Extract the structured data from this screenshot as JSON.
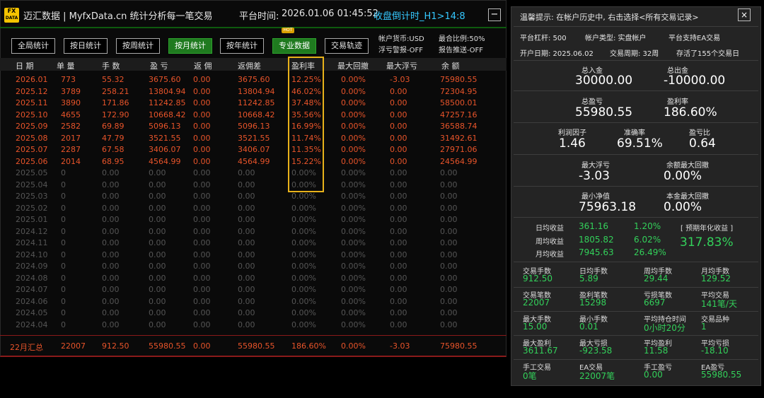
{
  "header": {
    "logo_top": "FX",
    "logo_bottom": "DATA",
    "title": "迈汇数据 | MyfxData.cn  统计分析每一笔交易",
    "platform_time_label": "平台时间:",
    "platform_time": "2026.01.06 01:45:52",
    "countdown": "收盘倒计时_H1>14:8",
    "minimize": "−"
  },
  "tabs": [
    {
      "label": "全局统计"
    },
    {
      "label": "按日统计"
    },
    {
      "label": "按周统计"
    },
    {
      "label": "按月统计"
    },
    {
      "label": "按年统计"
    },
    {
      "label": "专业数据"
    },
    {
      "label": "交易轨迹"
    }
  ],
  "hot_badge": "HOT",
  "info": {
    "currency": "帐户货币:USD",
    "float_alert": "浮亏警报-OFF",
    "max_ratio": "最合比例:50%",
    "report_push": "报告推送-OFF"
  },
  "columns": [
    "日 期",
    "单 量",
    "手 数",
    "盈 亏",
    "返 佣",
    "返佣差",
    "盈利率",
    "最大回撤",
    "最大浮亏",
    "余 额"
  ],
  "rows": [
    {
      "d": "2026.01",
      "n": "773",
      "lots": "55.32",
      "pl": "3675.60",
      "rb": "0.00",
      "rbd": "3675.60",
      "rate": "12.25%",
      "dd": "0.00%",
      "fl": "-3.03",
      "bal": "75980.55",
      "active": true
    },
    {
      "d": "2025.12",
      "n": "3789",
      "lots": "258.21",
      "pl": "13804.94",
      "rb": "0.00",
      "rbd": "13804.94",
      "rate": "46.02%",
      "dd": "0.00%",
      "fl": "0.00",
      "bal": "72304.95",
      "active": true
    },
    {
      "d": "2025.11",
      "n": "3890",
      "lots": "171.86",
      "pl": "11242.85",
      "rb": "0.00",
      "rbd": "11242.85",
      "rate": "37.48%",
      "dd": "0.00%",
      "fl": "0.00",
      "bal": "58500.01",
      "active": true
    },
    {
      "d": "2025.10",
      "n": "4655",
      "lots": "172.90",
      "pl": "10668.42",
      "rb": "0.00",
      "rbd": "10668.42",
      "rate": "35.56%",
      "dd": "0.00%",
      "fl": "0.00",
      "bal": "47257.16",
      "active": true
    },
    {
      "d": "2025.09",
      "n": "2582",
      "lots": "69.89",
      "pl": "5096.13",
      "rb": "0.00",
      "rbd": "5096.13",
      "rate": "16.99%",
      "dd": "0.00%",
      "fl": "0.00",
      "bal": "36588.74",
      "active": true
    },
    {
      "d": "2025.08",
      "n": "2017",
      "lots": "47.79",
      "pl": "3521.55",
      "rb": "0.00",
      "rbd": "3521.55",
      "rate": "11.74%",
      "dd": "0.00%",
      "fl": "0.00",
      "bal": "31492.61",
      "active": true
    },
    {
      "d": "2025.07",
      "n": "2287",
      "lots": "67.58",
      "pl": "3406.07",
      "rb": "0.00",
      "rbd": "3406.07",
      "rate": "11.35%",
      "dd": "0.00%",
      "fl": "0.00",
      "bal": "27971.06",
      "active": true
    },
    {
      "d": "2025.06",
      "n": "2014",
      "lots": "68.95",
      "pl": "4564.99",
      "rb": "0.00",
      "rbd": "4564.99",
      "rate": "15.22%",
      "dd": "0.00%",
      "fl": "0.00",
      "bal": "24564.99",
      "active": true
    },
    {
      "d": "2025.05",
      "n": "0",
      "lots": "0.00",
      "pl": "0.00",
      "rb": "0.00",
      "rbd": "0.00",
      "rate": "0.00%",
      "dd": "0.00%",
      "fl": "0.00",
      "bal": "0.00",
      "active": false
    },
    {
      "d": "2025.04",
      "n": "0",
      "lots": "0.00",
      "pl": "0.00",
      "rb": "0.00",
      "rbd": "0.00",
      "rate": "0.00%",
      "dd": "0.00%",
      "fl": "0.00",
      "bal": "0.00",
      "active": false
    },
    {
      "d": "2025.03",
      "n": "0",
      "lots": "0.00",
      "pl": "0.00",
      "rb": "0.00",
      "rbd": "0.00",
      "rate": "0.00%",
      "dd": "0.00%",
      "fl": "0.00",
      "bal": "0.00",
      "active": false
    },
    {
      "d": "2025.02",
      "n": "0",
      "lots": "0.00",
      "pl": "0.00",
      "rb": "0.00",
      "rbd": "0.00",
      "rate": "0.00%",
      "dd": "0.00%",
      "fl": "0.00",
      "bal": "0.00",
      "active": false
    },
    {
      "d": "2025.01",
      "n": "0",
      "lots": "0.00",
      "pl": "0.00",
      "rb": "0.00",
      "rbd": "0.00",
      "rate": "0.00%",
      "dd": "0.00%",
      "fl": "0.00",
      "bal": "0.00",
      "active": false
    },
    {
      "d": "2024.12",
      "n": "0",
      "lots": "0.00",
      "pl": "0.00",
      "rb": "0.00",
      "rbd": "0.00",
      "rate": "0.00%",
      "dd": "0.00%",
      "fl": "0.00",
      "bal": "0.00",
      "active": false
    },
    {
      "d": "2024.11",
      "n": "0",
      "lots": "0.00",
      "pl": "0.00",
      "rb": "0.00",
      "rbd": "0.00",
      "rate": "0.00%",
      "dd": "0.00%",
      "fl": "0.00",
      "bal": "0.00",
      "active": false
    },
    {
      "d": "2024.10",
      "n": "0",
      "lots": "0.00",
      "pl": "0.00",
      "rb": "0.00",
      "rbd": "0.00",
      "rate": "0.00%",
      "dd": "0.00%",
      "fl": "0.00",
      "bal": "0.00",
      "active": false
    },
    {
      "d": "2024.09",
      "n": "0",
      "lots": "0.00",
      "pl": "0.00",
      "rb": "0.00",
      "rbd": "0.00",
      "rate": "0.00%",
      "dd": "0.00%",
      "fl": "0.00",
      "bal": "0.00",
      "active": false
    },
    {
      "d": "2024.08",
      "n": "0",
      "lots": "0.00",
      "pl": "0.00",
      "rb": "0.00",
      "rbd": "0.00",
      "rate": "0.00%",
      "dd": "0.00%",
      "fl": "0.00",
      "bal": "0.00",
      "active": false
    },
    {
      "d": "2024.07",
      "n": "0",
      "lots": "0.00",
      "pl": "0.00",
      "rb": "0.00",
      "rbd": "0.00",
      "rate": "0.00%",
      "dd": "0.00%",
      "fl": "0.00",
      "bal": "0.00",
      "active": false
    },
    {
      "d": "2024.06",
      "n": "0",
      "lots": "0.00",
      "pl": "0.00",
      "rb": "0.00",
      "rbd": "0.00",
      "rate": "0.00%",
      "dd": "0.00%",
      "fl": "0.00",
      "bal": "0.00",
      "active": false
    },
    {
      "d": "2024.05",
      "n": "0",
      "lots": "0.00",
      "pl": "0.00",
      "rb": "0.00",
      "rbd": "0.00",
      "rate": "0.00%",
      "dd": "0.00%",
      "fl": "0.00",
      "bal": "0.00",
      "active": false
    },
    {
      "d": "2024.04",
      "n": "0",
      "lots": "0.00",
      "pl": "0.00",
      "rb": "0.00",
      "rbd": "0.00",
      "rate": "0.00%",
      "dd": "0.00%",
      "fl": "0.00",
      "bal": "0.00",
      "active": false
    }
  ],
  "summary": {
    "d": "22月汇总",
    "n": "22007",
    "lots": "912.50",
    "pl": "55980.55",
    "rb": "0.00",
    "rbd": "55980.55",
    "rate": "186.60%",
    "dd": "0.00%",
    "fl": "-3.03",
    "bal": "75980.55"
  },
  "right": {
    "tip": "温馨提示: 在帐户历史中, 右击选择<所有交易记录>",
    "close": "×",
    "leverage": "平台杠杆: 500",
    "account_type": "帐户类型: 实盘帐户",
    "ea_support": "平台支持EA交易",
    "open_date": "开户日期: 2025.06.02",
    "trade_period": "交易周期: 32周",
    "history": "存活了155个交易日",
    "deposit_label": "总入金",
    "deposit": "30000.00",
    "withdraw_label": "总出金",
    "withdraw": "-10000.00",
    "total_pl_label": "总盈亏",
    "total_pl": "55980.55",
    "profit_rate_label": "盈利率",
    "profit_rate": "186.60%",
    "pf_label": "利润因子",
    "pf": "1.46",
    "acc_label": "准确率",
    "acc": "69.51%",
    "plr_label": "盈亏比",
    "plr": "0.64",
    "max_float_label": "最大浮亏",
    "max_float": "-3.03",
    "bal_dd_label": "余额最大回撤",
    "bal_dd": "0.00%",
    "min_equity_label": "最小净值",
    "min_equity": "75963.18",
    "principal_dd_label": "本金最大回撤",
    "principal_dd": "0.00%",
    "daily_label": "日均收益",
    "daily": "361.16",
    "daily_pct": "1.20%",
    "weekly_label": "周均收益",
    "weekly": "1805.82",
    "weekly_pct": "6.02%",
    "monthly_label": "月均收益",
    "monthly": "7945.63",
    "monthly_pct": "26.49%",
    "annual_label": "[ 预期年化收益 ]",
    "annual": "317.83%",
    "grid": [
      [
        {
          "l": "交易手数",
          "v": "912.50"
        },
        {
          "l": "日均手数",
          "v": "5.89"
        },
        {
          "l": "周均手数",
          "v": "29.44"
        },
        {
          "l": "月均手数",
          "v": "129.52"
        }
      ],
      [
        {
          "l": "交易笔数",
          "v": "22007"
        },
        {
          "l": "盈利笔数",
          "v": "15298"
        },
        {
          "l": "亏损笔数",
          "v": "6697"
        },
        {
          "l": "平均交易",
          "v": "141笔/天"
        }
      ],
      [
        {
          "l": "最大手数",
          "v": "15.00"
        },
        {
          "l": "最小手数",
          "v": "0.01"
        },
        {
          "l": "平均持仓时间",
          "v": "0小时20分"
        },
        {
          "l": "交易品种",
          "v": "1"
        }
      ],
      [
        {
          "l": "最大盈利",
          "v": "3611.67"
        },
        {
          "l": "最大亏损",
          "v": "-923.58"
        },
        {
          "l": "平均盈利",
          "v": "11.58"
        },
        {
          "l": "平均亏损",
          "v": "-18.10"
        }
      ],
      [
        {
          "l": "手工交易",
          "v": "0笔"
        },
        {
          "l": "EA交易",
          "v": "22007笔"
        },
        {
          "l": "手工盈亏",
          "v": "0.00"
        },
        {
          "l": "EA盈亏",
          "v": "55980.55"
        }
      ]
    ]
  }
}
